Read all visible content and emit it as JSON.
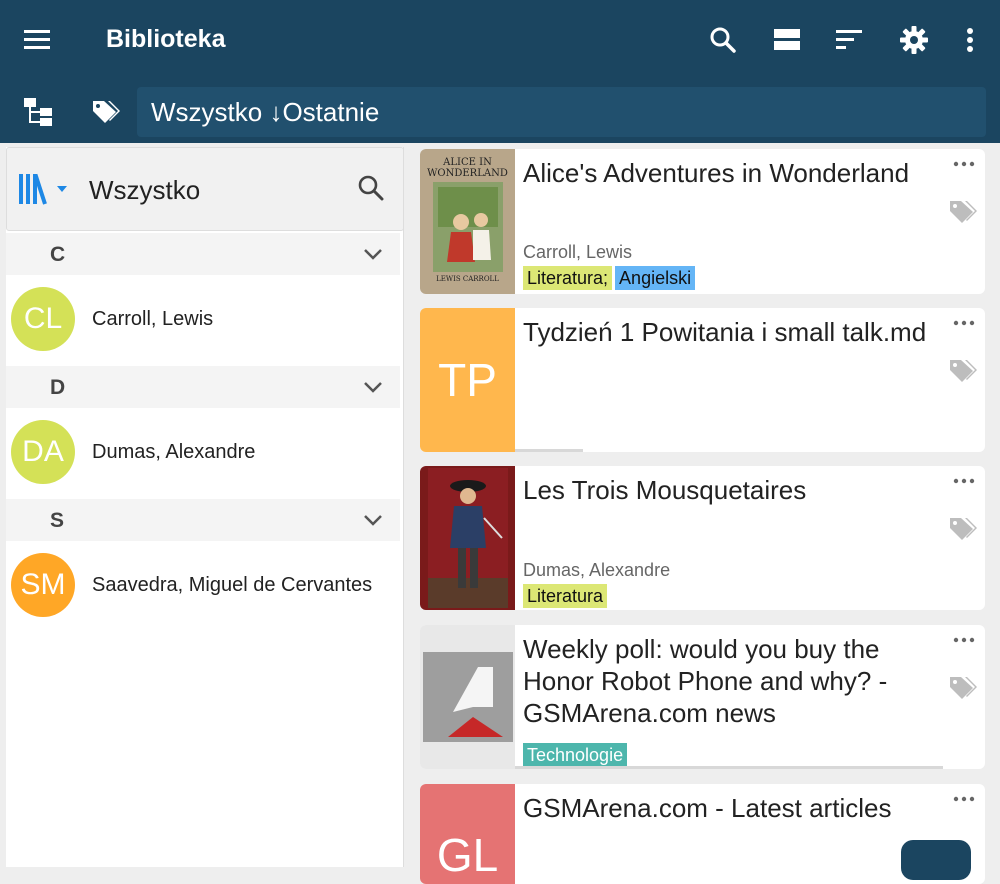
{
  "app": {
    "title": "Biblioteka"
  },
  "filter": {
    "text": "Wszystko ↓Ostatnie"
  },
  "sidebar": {
    "title": "Wszystko",
    "sections": [
      {
        "letter": "C",
        "authors": [
          {
            "initials": "CL",
            "name": "Carroll, Lewis",
            "color": "#d4e157"
          }
        ]
      },
      {
        "letter": "D",
        "authors": [
          {
            "initials": "DA",
            "name": "Dumas, Alexandre",
            "color": "#d4e157"
          }
        ]
      },
      {
        "letter": "S",
        "authors": [
          {
            "initials": "SM",
            "name": "Saavedra, Miguel de Cervantes",
            "color": "#ffa726"
          }
        ]
      }
    ]
  },
  "books": [
    {
      "title": "Alice's Adventures in Wonderland",
      "author": "Carroll, Lewis",
      "cover_title": "ALICE IN WONDERLAND",
      "cover_author": "LEWIS CARROLL",
      "tags": [
        {
          "label": "Literatura;",
          "color": "#dce775"
        },
        {
          "label": "Angielski",
          "color": "#64b5f6"
        }
      ]
    },
    {
      "title": "Tydzień 1 Powitania i small talk.md",
      "initials": "TP",
      "thumb_color": "#ffb74d",
      "tags": []
    },
    {
      "title": "Les Trois Mousquetaires",
      "author": "Dumas, Alexandre",
      "tags": [
        {
          "label": "Literatura",
          "color": "#dce775"
        }
      ]
    },
    {
      "title": "Weekly poll: would you buy the Honor Robot Phone and why? - GSMArena.com news",
      "tags": [
        {
          "label": "Technologie",
          "color": "#4db6ac"
        }
      ]
    },
    {
      "title": "GSMArena.com - Latest articles",
      "initials": "GL",
      "thumb_color": "#e57373",
      "tags": []
    }
  ],
  "colors": {
    "primary": "#1b4560",
    "accent": "#1e88e5"
  }
}
